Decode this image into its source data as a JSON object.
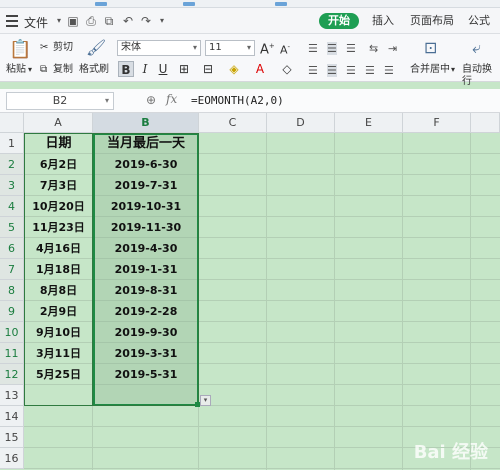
{
  "menubar": {
    "file_label": "文件",
    "tabs": [
      "开始",
      "插入",
      "页面布局",
      "公式"
    ],
    "active_tab": "开始"
  },
  "ribbon": {
    "paste": "粘贴",
    "cut": "剪切",
    "copy": "复制",
    "format_painter": "格式刷",
    "font_name": "宋体",
    "font_size": "11",
    "merge_center": "合并居中",
    "auto_wrap": "自动换行"
  },
  "formula_bar": {
    "name_box": "B2",
    "fx": "fx",
    "formula": "=EOMONTH(A2,0)"
  },
  "sheet": {
    "columns": [
      "A",
      "B",
      "C",
      "D",
      "E",
      "F"
    ],
    "rows": [
      "1",
      "2",
      "3",
      "4",
      "5",
      "6",
      "7",
      "8",
      "9",
      "10",
      "11",
      "12",
      "13",
      "14",
      "15",
      "16"
    ],
    "header_a": "日期",
    "header_b": "当月最后一天",
    "dates": [
      "6月2日",
      "7月3日",
      "10月20日",
      "11月23日",
      "4月16日",
      "1月18日",
      "8月8日",
      "2月9日",
      "9月10日",
      "3月11日",
      "5月25日"
    ],
    "eomonth": [
      "2019-6-30",
      "2019-7-31",
      "2019-10-31",
      "2019-11-30",
      "2019-4-30",
      "2019-1-31",
      "2019-8-31",
      "2019-2-28",
      "2019-9-30",
      "2019-3-31",
      "2019-5-31"
    ]
  },
  "watermark": "Bai 经验",
  "colors": {
    "accent": "#1e9e53",
    "sheet_bg": "#c6e6c8",
    "selection": "#1e8a44"
  }
}
